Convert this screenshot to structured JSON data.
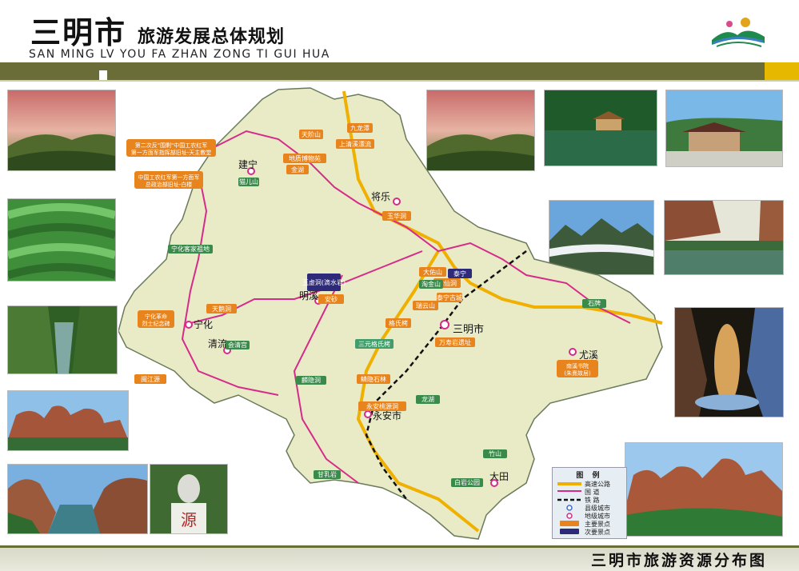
{
  "header": {
    "title_main": "三明市",
    "title_sub": "旅游发展总体规划",
    "pinyin": "SAN MING LV YOU FA ZHAN ZONG TI GUI HUA"
  },
  "footer": {
    "title": "三明市旅游资源分布图"
  },
  "colors": {
    "band": "#6b6d39",
    "accent": "#e7b800",
    "map_fill": "#e9ebc7",
    "highway": "#f0b000",
    "national_road": "#d62b8a",
    "railway": "#111111"
  },
  "map": {
    "cities": [
      {
        "name": "三明市",
        "type": "prefecture"
      },
      {
        "name": "将乐",
        "type": "county"
      },
      {
        "name": "建宁",
        "type": "county"
      },
      {
        "name": "明溪",
        "type": "county"
      },
      {
        "name": "宁化",
        "type": "county"
      },
      {
        "name": "清流",
        "type": "county"
      },
      {
        "name": "永安市",
        "type": "county"
      },
      {
        "name": "大田",
        "type": "county"
      },
      {
        "name": "尤溪",
        "type": "county"
      }
    ],
    "major_spots": [
      "九龙潭",
      "天阶山",
      "上清溪漂流",
      "玉华洞",
      "金湖",
      "地质博物苑",
      "泰宁古城",
      "闽江源",
      "天鹅洞",
      "玉虚洞(滴水岩)",
      "永安桃源洞",
      "鳞隐石林",
      "万寿岩遗址",
      "瑞云山",
      "格氏栲",
      "七仙洞",
      "大佑山",
      "泰宁",
      "安砂",
      "三元格氏栲"
    ],
    "minor_spots": [
      "猫儿山",
      "宁化客家祖地",
      "竹山",
      "龙湖",
      "淘金山",
      "会清宫",
      "白岩公园",
      "甘乳岩",
      "麟隐洞",
      "石牌"
    ],
    "annotations": [
      "第二次反\"围剿\"中国工农红军\n第一方面军指挥部旧址-天主教堂",
      "中国工农红军第一方面军\n总政治部旧址-白楼",
      "宁化革命\n烈士纪念碑",
      "南溪书院\n(朱熹故居)"
    ],
    "legend": {
      "title": "图 例",
      "items": [
        {
          "label": "高速公路",
          "kind": "highway"
        },
        {
          "label": "国  道",
          "kind": "national"
        },
        {
          "label": "铁  路",
          "kind": "railway"
        },
        {
          "label": "县级城市",
          "kind": "county"
        },
        {
          "label": "地级城市",
          "kind": "prefecture"
        },
        {
          "label": "主要景点",
          "kind": "major"
        },
        {
          "label": "次要景点",
          "kind": "minor"
        }
      ]
    }
  }
}
